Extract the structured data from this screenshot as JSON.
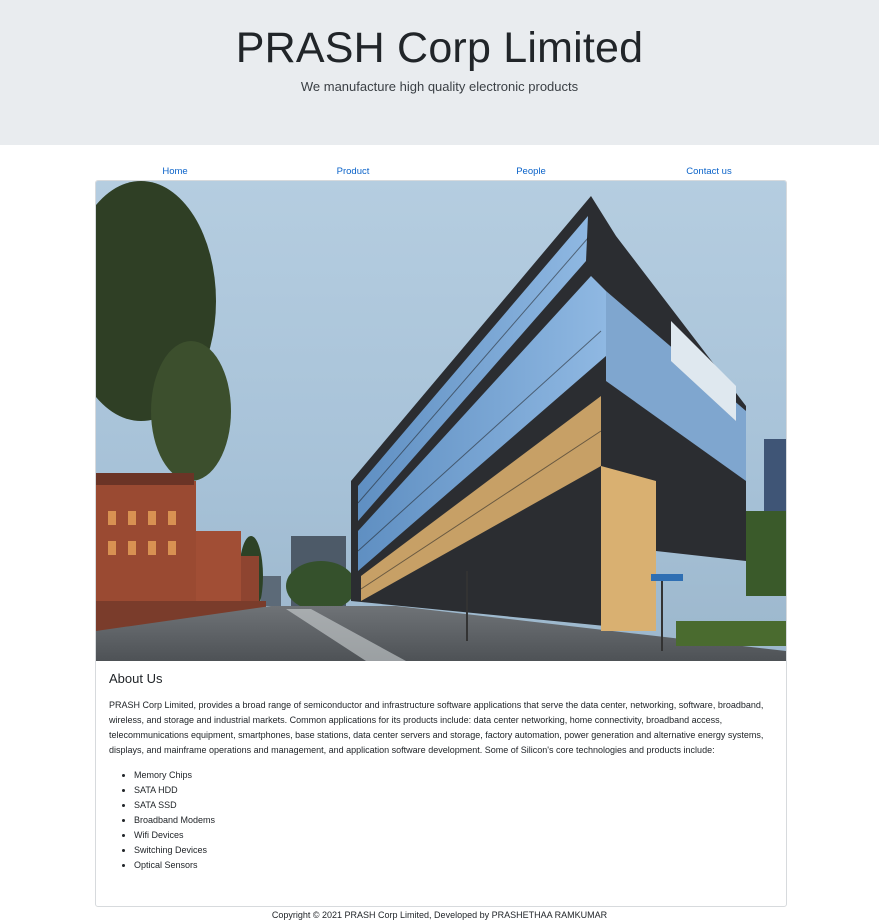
{
  "header": {
    "title": "PRASH Corp Limited",
    "tagline": "We manufacture high quality electronic products"
  },
  "nav": {
    "items": [
      {
        "label": "Home"
      },
      {
        "label": "Product"
      },
      {
        "label": "People"
      },
      {
        "label": "Contact us"
      }
    ]
  },
  "hero": {
    "image_alt": "office-building-photo"
  },
  "about": {
    "heading": "About Us",
    "body": "PRASH Corp Limited, provides a broad range of semiconductor and infrastructure software applications that serve the data center, networking, software, broadband, wireless, and storage and industrial markets. Common applications for its products include: data center networking, home connectivity, broadband access, telecommunications equipment, smartphones, base stations, data center servers and storage, factory automation, power generation and alternative energy systems, displays, and mainframe operations and management, and application software development. Some of Silicon's core technologies and products include:",
    "products": [
      "Memory Chips",
      "SATA HDD",
      "SATA SSD",
      "Broadband Modems",
      "Wifi Devices",
      "Switching Devices",
      "Optical Sensors"
    ]
  },
  "footer": {
    "text": "Copyright © 2021 PRASH Corp Limited, Developed by PRASHETHAA RAMKUMAR"
  }
}
